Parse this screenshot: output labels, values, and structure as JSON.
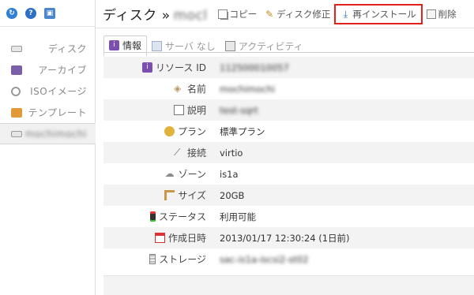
{
  "sidebar": {
    "tools": [
      {
        "icon": "refresh-icon",
        "color": "#2f7fd6",
        "glyph": "↻"
      },
      {
        "icon": "help-icon",
        "color": "#2f6fc6",
        "glyph": "?"
      },
      {
        "icon": "window-icon",
        "color": "#4a86c9",
        "glyph": "▣"
      }
    ],
    "items": [
      {
        "label": "ディスク",
        "icon": "disk-icon"
      },
      {
        "label": "アーカイブ",
        "icon": "archive-icon"
      },
      {
        "label": "ISOイメージ",
        "icon": "iso-image-icon"
      },
      {
        "label": "テンプレート",
        "icon": "template-icon"
      },
      {
        "label": "mochimochi",
        "icon": "disk-icon",
        "selected": true
      }
    ]
  },
  "header": {
    "title": "ディスク »",
    "title_blurred": "mocl",
    "actions": [
      {
        "label": "コピー",
        "icon": "copy-icon"
      },
      {
        "label": "ディスク修正",
        "icon": "wrench-icon"
      },
      {
        "label": "再インストール",
        "icon": "reinstall-icon",
        "highlighted": true
      },
      {
        "label": "削除",
        "icon": "delete-icon"
      }
    ]
  },
  "tabs": [
    {
      "label": "情報",
      "icon": "info-icon",
      "active": true
    },
    {
      "label": "サーバ なし",
      "icon": "server-icon"
    },
    {
      "label": "アクティビティ",
      "icon": "activity-icon"
    }
  ],
  "info": [
    {
      "label": "リソース ID",
      "icon": "info-icon",
      "value": "112500010057",
      "blurred": true
    },
    {
      "label": "名前",
      "icon": "tag-icon",
      "value": "mochimochi",
      "blurred": true
    },
    {
      "label": "説明",
      "icon": "note-icon",
      "value": "test-sqrt",
      "blurred": true
    },
    {
      "label": "プラン",
      "icon": "plan-icon",
      "value": "標準プラン"
    },
    {
      "label": "接続",
      "icon": "road-icon",
      "value": "virtio"
    },
    {
      "label": "ゾーン",
      "icon": "cloud-icon",
      "value": "is1a"
    },
    {
      "label": "サイズ",
      "icon": "ruler-icon",
      "value": "20GB"
    },
    {
      "label": "ステータス",
      "icon": "traffic-light-icon",
      "value": "利用可能"
    },
    {
      "label": "作成日時",
      "icon": "calendar-icon",
      "value": "2013/01/17 12:30:24 (1日前)"
    },
    {
      "label": "ストレージ",
      "icon": "storage-icon",
      "value": "sac-is1a-iscsi2-st02",
      "blurred": true
    }
  ],
  "colors": {
    "highlight": "#e0221f",
    "accent": "#2f6fc6"
  }
}
